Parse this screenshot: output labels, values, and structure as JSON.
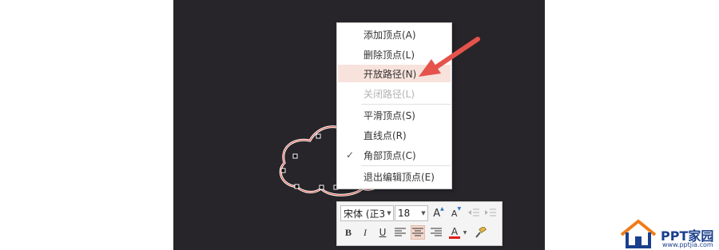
{
  "context_menu": {
    "items": [
      {
        "label": "添加顶点(A)",
        "state": "normal"
      },
      {
        "label": "删除顶点(L)",
        "state": "normal"
      },
      {
        "label": "开放路径(N)",
        "state": "highlighted"
      },
      {
        "label": "关闭路径(L)",
        "state": "disabled"
      },
      {
        "label": "平滑顶点(S)",
        "state": "normal"
      },
      {
        "label": "直线点(R)",
        "state": "normal"
      },
      {
        "label": "角部顶点(C)",
        "state": "checked"
      },
      {
        "label": "退出编辑顶点(E)",
        "state": "normal"
      }
    ],
    "check_mark": "✓"
  },
  "mini_toolbar": {
    "font_name": "宋体 (正3",
    "font_size": "18",
    "grow_font_label": "A",
    "shrink_font_label": "A",
    "bold_label": "B",
    "italic_label": "I",
    "underline_label": "U",
    "font_color_label": "A",
    "font_color": "#e0201b"
  },
  "logo": {
    "title": "PPT家园",
    "url": "www.pptjia.com"
  },
  "colors": {
    "canvas_background": "#27252a",
    "arrow": "#e5534b",
    "menu_highlight": "#f7e2dc",
    "shape_outline": "#ffffff",
    "shape_path": "#d94a3a"
  }
}
